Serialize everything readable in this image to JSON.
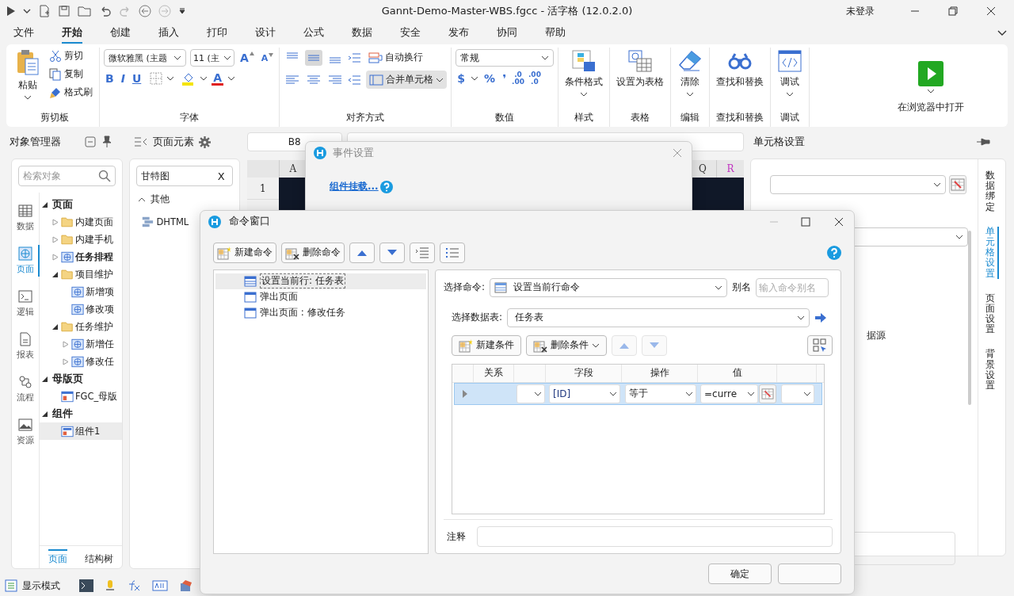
{
  "title_bar": {
    "title": "Gannt-Demo-Master-WBS.fgcc - 活字格 (12.0.2.0)",
    "login": "未登录"
  },
  "menu_tabs": [
    {
      "label": "文件",
      "selected": false
    },
    {
      "label": "开始",
      "selected": true
    },
    {
      "label": "创建",
      "selected": false
    },
    {
      "label": "插入",
      "selected": false
    },
    {
      "label": "打印",
      "selected": false
    },
    {
      "label": "设计",
      "selected": false
    },
    {
      "label": "公式",
      "selected": false
    },
    {
      "label": "数据",
      "selected": false
    },
    {
      "label": "安全",
      "selected": false
    },
    {
      "label": "发布",
      "selected": false
    },
    {
      "label": "协同",
      "selected": false
    },
    {
      "label": "帮助",
      "selected": false
    }
  ],
  "ribbon": {
    "clipboard": {
      "title": "剪切板",
      "paste": "粘贴",
      "items": [
        "剪切",
        "复制",
        "格式刷"
      ]
    },
    "font": {
      "title": "字体",
      "family": "微软雅黑 (主题",
      "size": "11 (主",
      "grow": "A",
      "shrink": "A",
      "styles": [
        "B",
        "I",
        "U"
      ],
      "color_letter": "A"
    },
    "align": {
      "title": "对齐方式",
      "wrap": "自动换行",
      "merge": "合并单元格"
    },
    "number": {
      "title": "数值",
      "format": "常规",
      "symbols": [
        "$",
        "%",
        "❜"
      ],
      "decimals": [
        {
          "top": ".0",
          "bottom": ".00"
        },
        {
          "top": ".00",
          "bottom": ".0"
        }
      ]
    },
    "big_buttons": [
      {
        "label": "条件格式",
        "group": "样式",
        "dropdown": true
      },
      {
        "label": "设置为表格",
        "group": "表格",
        "dropdown": false
      },
      {
        "label": "清除",
        "group": "编辑",
        "dropdown": true
      },
      {
        "label": "查找和替换",
        "group": "查找和替换",
        "dropdown": false
      },
      {
        "label": "调试",
        "group": "调试",
        "dropdown": true
      }
    ],
    "run": {
      "label": "在浏览器中打开"
    }
  },
  "object_manager": {
    "title": "对象管理器",
    "search": {
      "placeholder": "检索对象"
    },
    "nav": [
      {
        "label": "数据",
        "selected": false
      },
      {
        "label": "页面",
        "selected": true
      },
      {
        "label": "逻辑",
        "selected": false
      },
      {
        "label": "报表",
        "selected": false
      },
      {
        "label": "流程",
        "selected": false
      },
      {
        "label": "资源",
        "selected": false
      }
    ],
    "tree": [
      {
        "label": "页面",
        "kind": "section",
        "expandable": true,
        "expanded": true,
        "bold": true,
        "selected": false,
        "children": [
          {
            "label": "内建页面",
            "kind": "folder",
            "expandable": true,
            "expanded": false,
            "bold": false,
            "selected": false
          },
          {
            "label": "内建手机",
            "kind": "folder",
            "expandable": true,
            "expanded": false,
            "bold": false,
            "selected": false
          },
          {
            "label": "任务排程",
            "kind": "page",
            "expandable": true,
            "expanded": false,
            "bold": true,
            "selected": false
          },
          {
            "label": "项目维护",
            "kind": "folder",
            "expandable": true,
            "expanded": true,
            "bold": false,
            "selected": false,
            "children": [
              {
                "label": "新增项",
                "kind": "page",
                "expandable": false,
                "bold": false,
                "selected": false
              },
              {
                "label": "修改项",
                "kind": "page",
                "expandable": false,
                "bold": false,
                "selected": false
              }
            ]
          },
          {
            "label": "任务维护",
            "kind": "folder",
            "expandable": true,
            "expanded": true,
            "bold": false,
            "selected": false,
            "children": [
              {
                "label": "新增任",
                "kind": "page",
                "expandable": true,
                "expanded": false,
                "bold": false,
                "selected": false
              },
              {
                "label": "修改任",
                "kind": "page",
                "expandable": true,
                "expanded": false,
                "bold": false,
                "selected": false
              }
            ]
          }
        ]
      },
      {
        "label": "母版页",
        "kind": "section",
        "expandable": true,
        "expanded": true,
        "bold": true,
        "selected": false,
        "children": [
          {
            "label": "FGC_母版",
            "kind": "master",
            "expandable": false,
            "bold": false,
            "selected": false
          }
        ]
      },
      {
        "label": "组件",
        "kind": "section",
        "expandable": true,
        "expanded": true,
        "bold": true,
        "selected": false,
        "children": [
          {
            "label": "组件1",
            "kind": "component",
            "expandable": false,
            "bold": false,
            "selected": true
          }
        ]
      }
    ],
    "bottom_tabs": [
      {
        "label": "页面",
        "selected": true
      },
      {
        "label": "结构树",
        "selected": false
      }
    ]
  },
  "page_elements": {
    "title": "页面元素",
    "search": {
      "value": "甘特图",
      "clear": "X"
    },
    "group": {
      "label": "其他",
      "expanded": true
    },
    "items": [
      {
        "label": "DHTML"
      }
    ]
  },
  "sheet": {
    "name_box": "B8",
    "columns": [
      {
        "label": "A",
        "color": "#333333"
      },
      {
        "label": "Q",
        "color": "#333333"
      },
      {
        "label": "R",
        "color": "#c030c0"
      }
    ],
    "rows": [
      {
        "label": "1"
      }
    ]
  },
  "cell_settings": {
    "title": "单元格设置",
    "partial_text": "据源",
    "tabs": [
      {
        "label": "数据绑定",
        "selected": false
      },
      {
        "label": "单元格设置",
        "selected": true
      },
      {
        "label": "页面设置",
        "selected": false
      },
      {
        "label": "背景设置",
        "selected": false
      }
    ]
  },
  "event_dialog": {
    "title": "事件设置",
    "link": "组件挂载..."
  },
  "command_window": {
    "title": "命令窗口",
    "toolbar": [
      "新建命令",
      "删除命令"
    ],
    "commands": [
      {
        "label": "设置当前行: 任务表",
        "kind": "rows",
        "selected": true
      },
      {
        "label": "弹出页面",
        "kind": "window",
        "selected": false
      },
      {
        "label": "弹出页面 : 修改任务",
        "kind": "window",
        "selected": false
      }
    ],
    "select_command": {
      "label": "选择命令:",
      "value": "设置当前行命令"
    },
    "alias": {
      "label": "别名",
      "placeholder": "输入命令别名"
    },
    "data_table": {
      "label": "选择数据表:",
      "value": "任务表"
    },
    "condition_buttons": [
      {
        "label": "新建条件",
        "dropdown": false
      },
      {
        "label": "删除条件",
        "dropdown": true
      }
    ],
    "columns": [
      "关系",
      "字段",
      "操作",
      "值"
    ],
    "conditions": [
      {
        "field": "[ID]",
        "operator": "等于",
        "value": "=curre",
        "selected": true
      }
    ],
    "note": {
      "label": "注释"
    },
    "ok": "确定"
  },
  "status_bar": {
    "mode": "显示模式"
  }
}
